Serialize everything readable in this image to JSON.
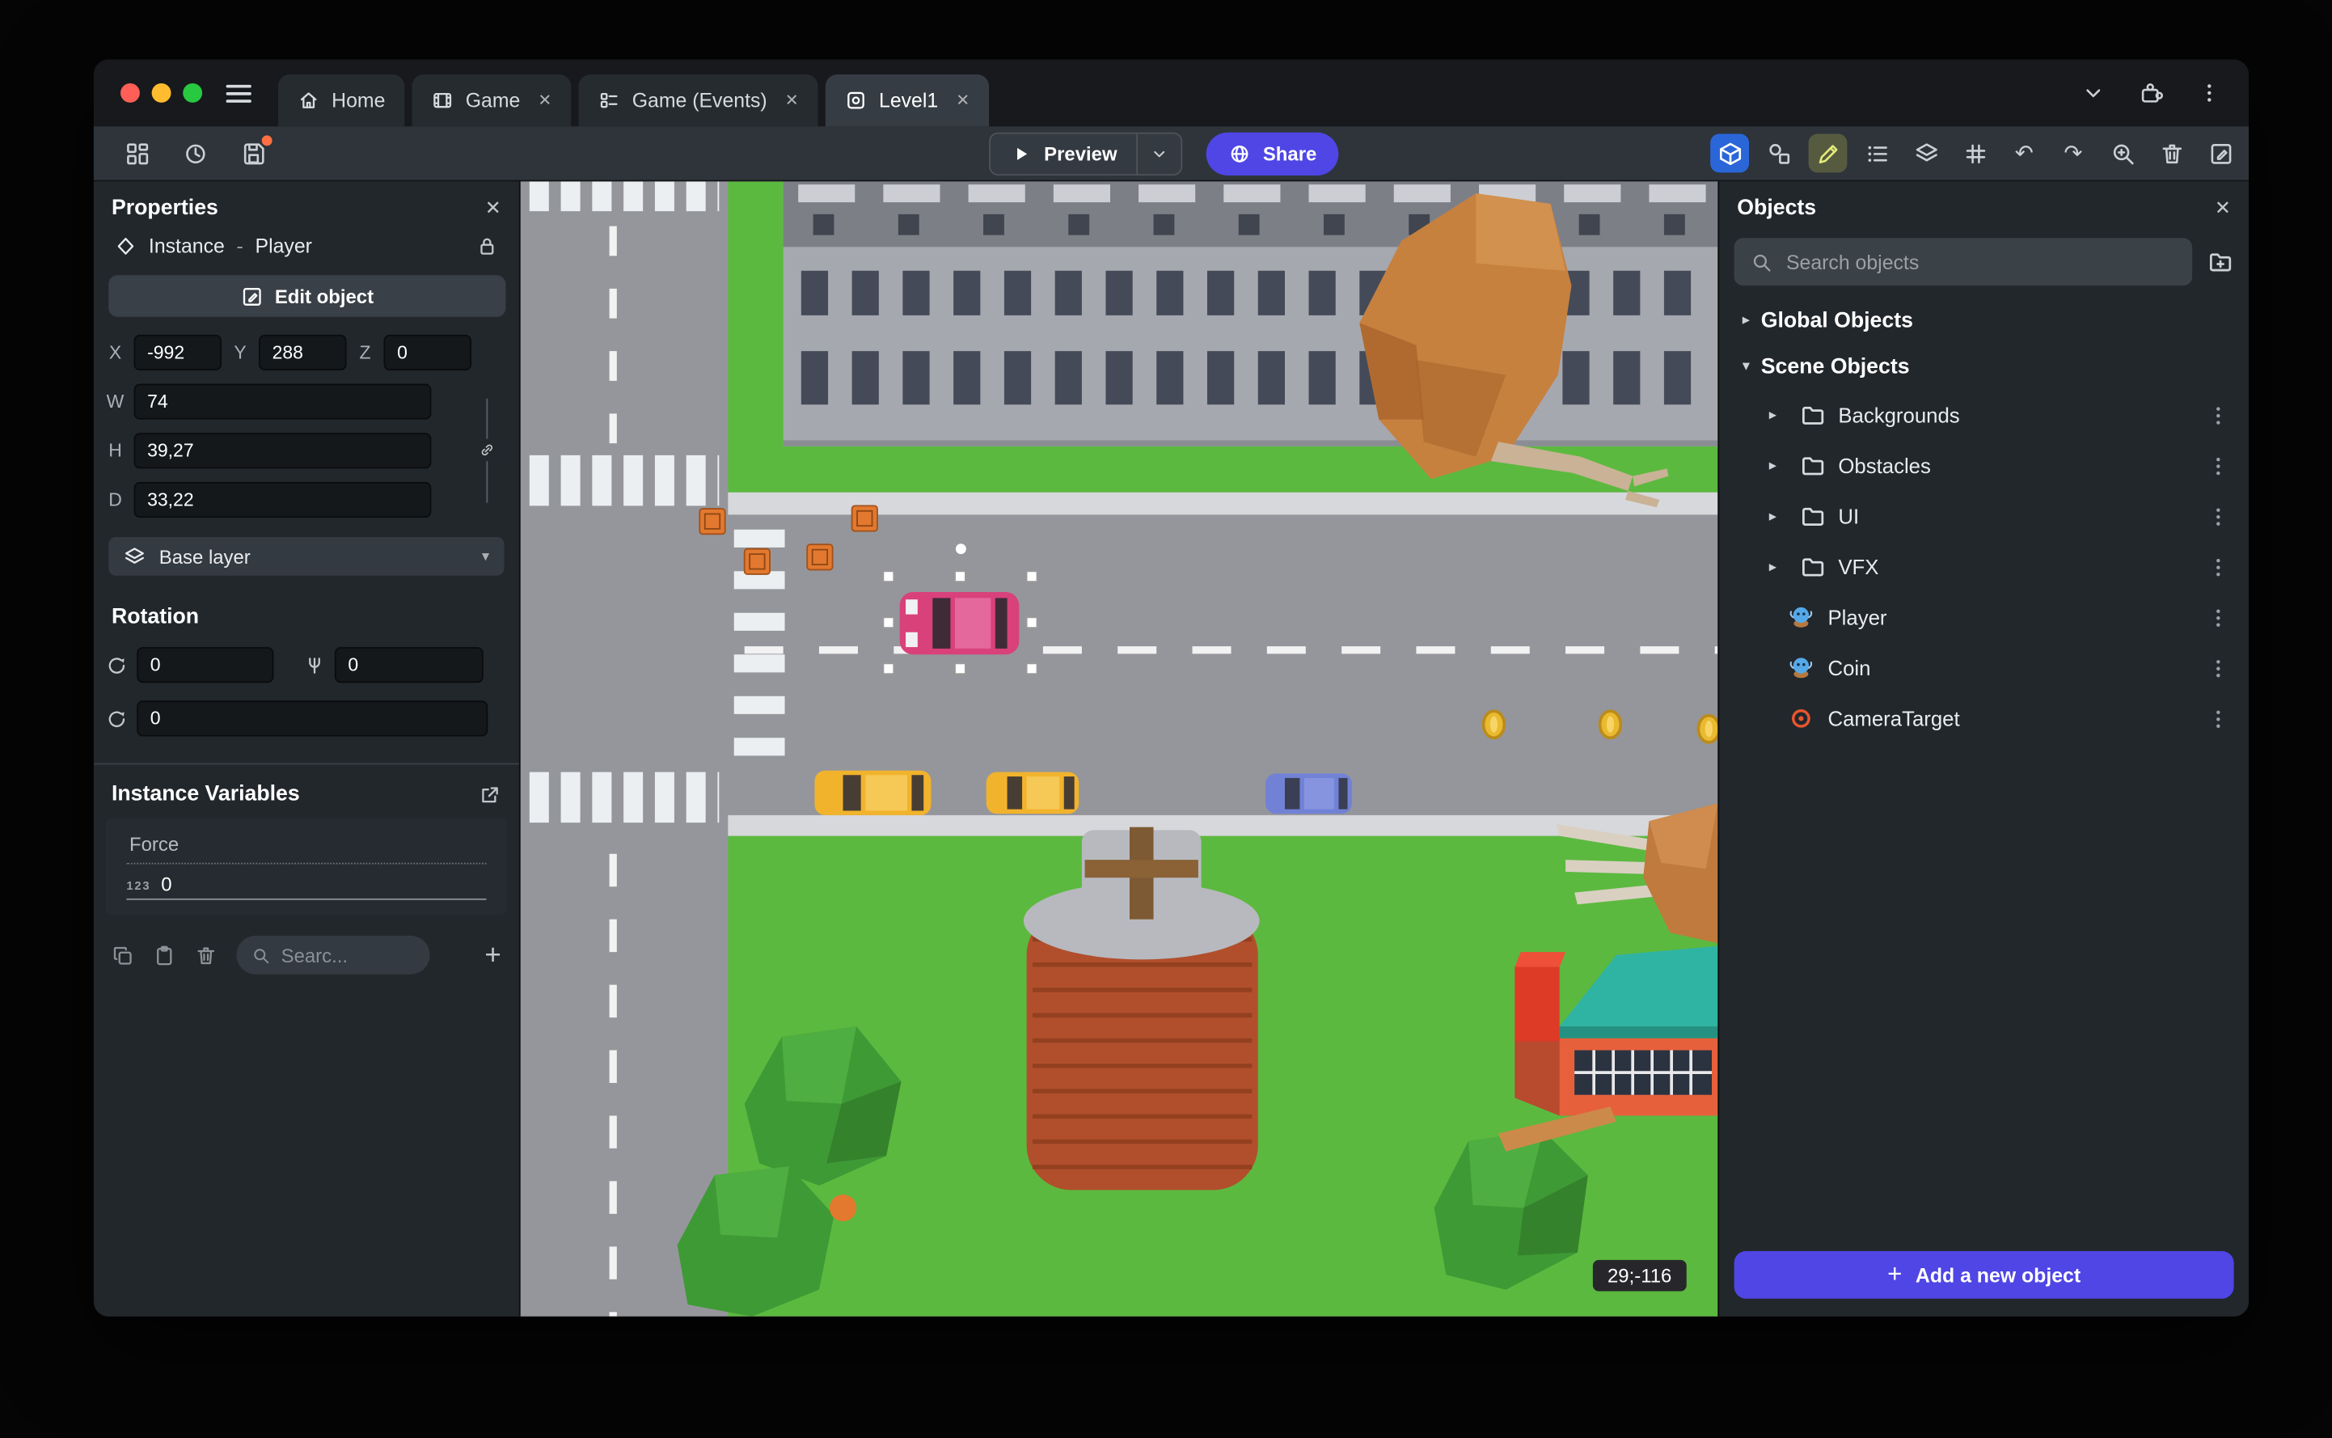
{
  "icons": {
    "close": "✕",
    "chevron_right": "▸",
    "chevron_down": "▾",
    "plus": "+",
    "undo": "↶",
    "redo": "↷"
  },
  "titlebar": {
    "tabs": [
      {
        "label": "Home"
      },
      {
        "label": "Game"
      },
      {
        "label": "Game (Events)"
      },
      {
        "label": "Level1"
      }
    ]
  },
  "toolbar": {
    "preview": "Preview",
    "share": "Share"
  },
  "properties": {
    "title": "Properties",
    "instance_kind": "Instance",
    "dash": "-",
    "object_name": "Player",
    "edit_object": "Edit object",
    "x_label": "X",
    "x": "-992",
    "y_label": "Y",
    "y": "288",
    "z_label": "Z",
    "z": "0",
    "w_label": "W",
    "w": "74",
    "h_label": "H",
    "h": "39,27",
    "d_label": "D",
    "d": "33,22",
    "layer": "Base layer",
    "rotation_title": "Rotation",
    "rot_x": "0",
    "rot_y": "0",
    "rot_z": "0",
    "variables_title": "Instance Variables",
    "variable_name": "Force",
    "variable_type": "123",
    "variable_value": "0",
    "search_placeholder": "Searc..."
  },
  "scene": {
    "coords": "29;-116"
  },
  "objects": {
    "title": "Objects",
    "search_placeholder": "Search objects",
    "global_group": "Global Objects",
    "scene_group": "Scene Objects",
    "folders": [
      {
        "label": "Backgrounds"
      },
      {
        "label": "Obstacles"
      },
      {
        "label": "UI"
      },
      {
        "label": "VFX"
      }
    ],
    "items": [
      {
        "label": "Player"
      },
      {
        "label": "Coin"
      },
      {
        "label": "CameraTarget"
      }
    ],
    "add_button": "Add a new object"
  },
  "colors": {
    "accent": "#4f46e5",
    "toolbar_active_tile": "#2b66d9",
    "grass": "#5cb93f",
    "selection_handle": "#ffffff",
    "traffic_red": "#ff5f57",
    "traffic_yellow": "#febc2e",
    "traffic_green": "#28c840"
  }
}
